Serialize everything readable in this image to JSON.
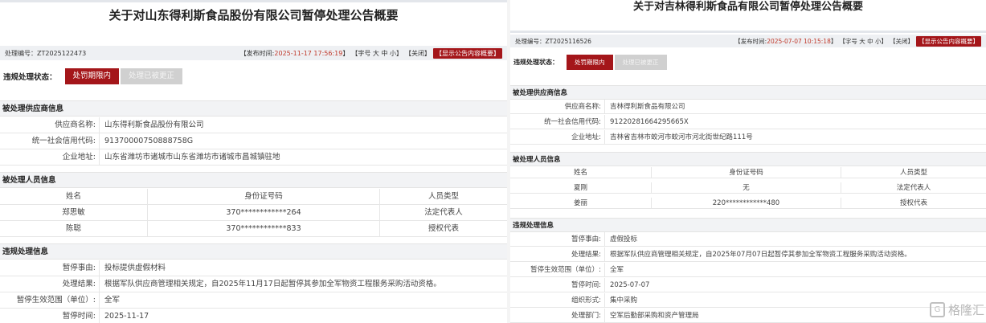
{
  "left": {
    "title": "关于对山东得利斯食品股份有限公司暂停处理公告概要",
    "meta": {
      "code_label": "处理编号：",
      "code": "ZT2025122473",
      "publish_label": "【发布时间:",
      "publish_time": "2025-11-17 17:56:19",
      "publish_close": "】",
      "font_size": "【字号 大 中 小】",
      "close": "【关闭】",
      "show_summary": "【显示公告内容概要】"
    },
    "status": {
      "label": "违规处理状态：",
      "active": "处罚期限内",
      "inactive": "处理已被更正"
    },
    "supplier": {
      "heading": "被处理供应商信息",
      "rows": [
        {
          "label": "供应商名称:",
          "value": "山东得利斯食品股份有限公司"
        },
        {
          "label": "统一社会信用代码:",
          "value": "91370000750888758G"
        },
        {
          "label": "企业地址:",
          "value": "山东省潍坊市诸城市山东省潍坊市诸城市昌城镇驻地"
        }
      ]
    },
    "persons": {
      "heading": "被处理人员信息",
      "columns": [
        "姓名",
        "身份证号码",
        "人员类型"
      ],
      "rows": [
        [
          "郑思敏",
          "370************264",
          "法定代表人"
        ],
        [
          "陈聪",
          "370************833",
          "授权代表"
        ]
      ]
    },
    "violation": {
      "heading": "违规处理信息",
      "rows": [
        {
          "label": "暂停事由:",
          "value": "投标提供虚假材料"
        },
        {
          "label": "处理结果:",
          "value": "根据军队供应商管理相关规定，自2025年11月17日起暂停其参加全军物资工程服务采购活动资格。"
        },
        {
          "label": "暂停生效范围（单位）:",
          "value": "全军"
        },
        {
          "label": "暂停时间:",
          "value": "2025-11-17"
        }
      ]
    }
  },
  "right": {
    "title": "关于对吉林得利斯食品有限公司暂停处理公告概要",
    "meta": {
      "code_label": "处理编号：",
      "code": "ZT2025116526",
      "publish_label": "【发布时间:",
      "publish_time": "2025-07-07 10:15:18",
      "publish_close": "】",
      "font_size": "【字号 大 中 小】",
      "close": "【关闭】",
      "show_summary": "【显示公告内容概要】"
    },
    "status": {
      "label": "违规处理状态：",
      "active": "处罚期限内",
      "inactive": "处理已被更正"
    },
    "supplier": {
      "heading": "被处理供应商信息",
      "rows": [
        {
          "label": "供应商名称:",
          "value": "吉林得利斯食品有限公司"
        },
        {
          "label": "统一社会信用代码:",
          "value": "91220281664295665X"
        },
        {
          "label": "企业地址:",
          "value": "吉林省吉林市蛟河市蛟河市河北街世纪路111号"
        }
      ]
    },
    "persons": {
      "heading": "被处理人员信息",
      "columns": [
        "姓名",
        "身份证号码",
        "人员类型"
      ],
      "rows": [
        [
          "夏刚",
          "无",
          "法定代表人"
        ],
        [
          "姜丽",
          "220************480",
          "授权代表"
        ]
      ]
    },
    "violation": {
      "heading": "违规处理信息",
      "rows": [
        {
          "label": "暂停事由:",
          "value": "虚假投标"
        },
        {
          "label": "处理结果:",
          "value": "根据军队供应商管理相关规定，自2025年07月07日起暂停其参加全军物资工程服务采购活动资格。"
        },
        {
          "label": "暂停生效范围（单位）:",
          "value": "全军"
        },
        {
          "label": "暂停时间:",
          "value": "2025-07-07"
        },
        {
          "label": "组织形式:",
          "value": "集中采购"
        },
        {
          "label": "处理部门:",
          "value": "空军后勤部采购和资产管理局"
        }
      ]
    },
    "watermark": {
      "text": "格隆汇",
      "icon": "gelonghui-logo-icon"
    }
  }
}
